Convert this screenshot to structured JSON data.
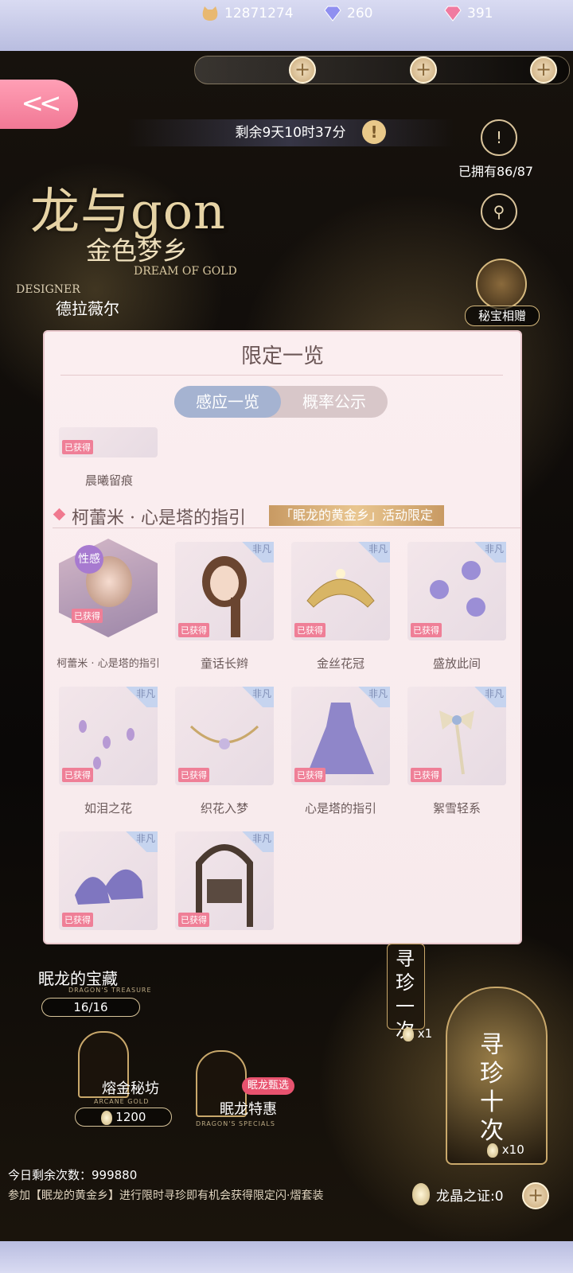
{
  "currency": {
    "coins": "12871274",
    "diamonds_blue": "260",
    "diamonds_pink": "391"
  },
  "timer": {
    "text": "剩余9天10时37分"
  },
  "side": {
    "owned": "已拥有86/87",
    "gift_label": "秘宝相赠"
  },
  "logo": {
    "main": "龙与gon",
    "sub": "金色梦乡",
    "en": "DREAM OF GOLD",
    "designer_label": "DESIGNER",
    "designer_name": "德拉薇尔"
  },
  "modal": {
    "title": "限定一览",
    "tabs": [
      "感应一览",
      "概率公示"
    ],
    "prev_item": {
      "label": "晨曦留痕",
      "tag": "已获得"
    },
    "section": {
      "title": "柯蕾米 · 心是塔的指引",
      "badge": "「眠龙的黄金乡」活动限定"
    },
    "hero": {
      "badge": "性感",
      "tag": "已获得",
      "label": "柯蕾米 · 心是塔的指引"
    },
    "items": [
      {
        "label": "童话长辫",
        "tag": "已获得",
        "rarity": "非凡"
      },
      {
        "label": "金丝花冠",
        "tag": "已获得",
        "rarity": "非凡"
      },
      {
        "label": "盛放此间",
        "tag": "已获得",
        "rarity": "非凡"
      },
      {
        "label": "如泪之花",
        "tag": "已获得",
        "rarity": "非凡"
      },
      {
        "label": "织花入梦",
        "tag": "已获得",
        "rarity": "非凡"
      },
      {
        "label": "心是塔的指引",
        "tag": "已获得",
        "rarity": "非凡"
      },
      {
        "label": "絮雪轻系",
        "tag": "已获得",
        "rarity": "非凡"
      },
      {
        "label": "",
        "tag": "已获得",
        "rarity": "非凡"
      },
      {
        "label": "",
        "tag": "已获得",
        "rarity": "非凡"
      }
    ]
  },
  "treasure": {
    "title": "眠龙的宝藏",
    "en": "DRAGON'S TREASURE",
    "count": "16/16"
  },
  "shops": {
    "gold": {
      "label": "熔金秘坊",
      "en": "ARCANE GOLD",
      "price": "1200"
    },
    "special": {
      "label": "眠龙特惠",
      "en": "DRAGON'S SPECIALS",
      "badge": "眠龙甄选"
    }
  },
  "draw": {
    "one_text": "寻珍一次",
    "one_cost": "x1",
    "ten_text": "寻珍十次",
    "ten_cost": "x10"
  },
  "footer": {
    "remaining": "今日剩余次数：999880",
    "note": "参加【眠龙的黄金乡】进行限时寻珍即有机会获得限定闪·熠套装",
    "proof": "龙晶之证:0"
  }
}
